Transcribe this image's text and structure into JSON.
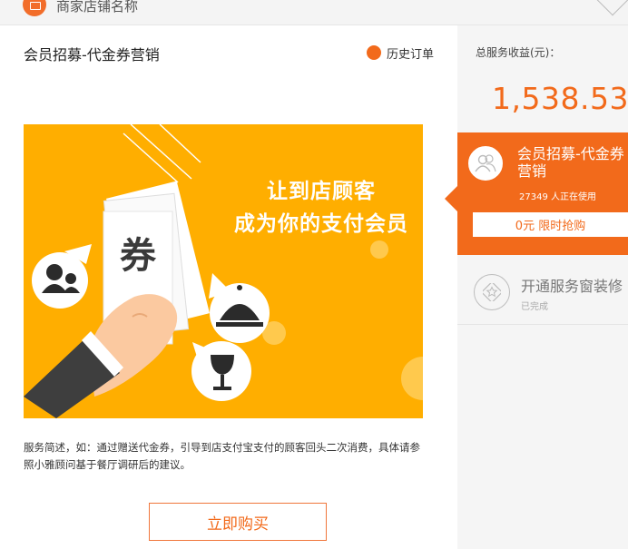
{
  "header": {
    "shop_name": "商家店铺名称"
  },
  "main": {
    "title": "会员招募-代金券营销",
    "history_label": "历史订单",
    "banner": {
      "line1": "让到店顾客",
      "line2": "成为你的支付会员",
      "coupon_char": "券"
    },
    "description": "服务简述，如：通过赠送代金券，引导到店支付宝支付的顾客回头二次消费，具体请参照小雅顾问基于餐厅调研后的建议。",
    "buy_label": "立即购买"
  },
  "side": {
    "revenue_label": "总服务收益(元)：",
    "revenue_value": "1,538.53",
    "active_card": {
      "title_line1": "会员招募-代金券",
      "title_line2": "营销",
      "users": "27349 人正在使用",
      "buy_label": "0元 限时抢购"
    },
    "next_item": {
      "title": "开通服务窗装修",
      "status": "已完成"
    }
  },
  "colors": {
    "accent": "#f26a1b",
    "banner_bg": "#ffae00"
  }
}
